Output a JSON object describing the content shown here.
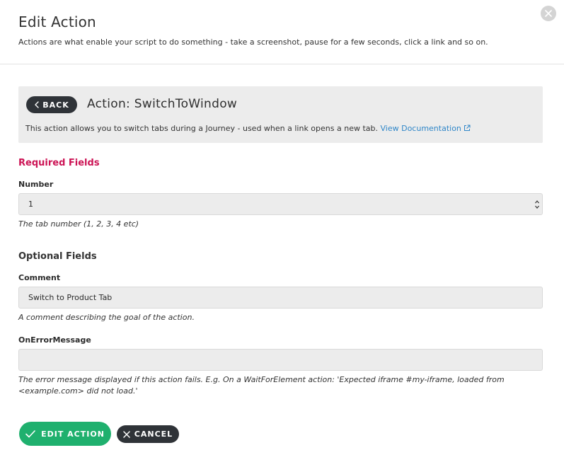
{
  "modal": {
    "title": "Edit Action",
    "subtitle": "Actions are what enable your script to do something - take a screenshot, pause for a few seconds, click a link and so on.",
    "close_icon": "close-icon"
  },
  "action_panel": {
    "back_label": "BACK",
    "back_icon": "chevron-left-icon",
    "title": "Action: SwitchToWindow",
    "description": "This action allows you to switch tabs during a Journey - used when a link opens a new tab.",
    "doc_link_label": "View Documentation",
    "doc_link_icon": "external-link-icon",
    "link_color": "#2f86c8"
  },
  "required": {
    "title": "Required Fields",
    "title_color": "#cc1455",
    "number": {
      "label": "Number",
      "value": "1",
      "help": "The tab number (1, 2, 3, 4 etc)"
    }
  },
  "optional": {
    "title": "Optional Fields",
    "comment": {
      "label": "Comment",
      "value": "Switch to Product Tab",
      "help": "A comment describing the goal of the action."
    },
    "on_error": {
      "label": "OnErrorMessage",
      "value": "",
      "help_line1": "The error message displayed if this action fails. E.g. On a WaitForElement action: 'Expected iframe #my-iframe, loaded from",
      "help_line2": "<example.com> did not load.'"
    }
  },
  "footer": {
    "edit_label": "EDIT ACTION",
    "edit_icon": "checkmark-icon",
    "edit_color": "#1fb06e",
    "cancel_label": "CANCEL",
    "cancel_icon": "close-icon"
  }
}
